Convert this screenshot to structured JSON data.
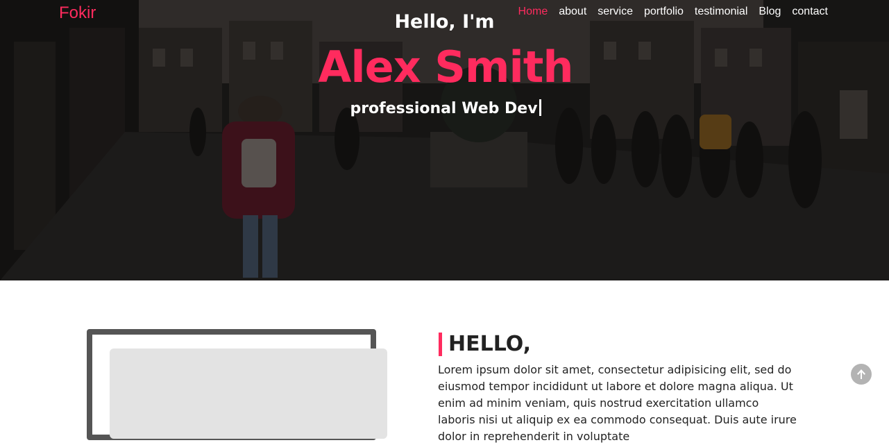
{
  "brand": {
    "name": "Fokir",
    "color": "#ff2b5e"
  },
  "nav": {
    "items": [
      {
        "label": "Home",
        "active": true
      },
      {
        "label": "about"
      },
      {
        "label": "service"
      },
      {
        "label": "portfolio"
      },
      {
        "label": "testimonial"
      },
      {
        "label": "Blog"
      },
      {
        "label": "contact"
      }
    ]
  },
  "hero": {
    "greeting": "Hello, I'm",
    "name": "Alex Smith",
    "role": "professional Web Dev",
    "background_icon": "street-photo"
  },
  "about": {
    "heading": "HELLO,",
    "text": "Lorem ipsum dolor sit amet, consectetur adipisicing elit, sed do eiusmod tempor incididunt ut labore et dolore magna aliqua. Ut enim ad minim veniam, quis nostrud exercitation ullamco laboris nisi ut aliquip ex ea commodo consequat. Duis aute irure dolor in reprehenderit in voluptate"
  },
  "scroll_top": {
    "icon": "arrow-up-icon"
  },
  "colors": {
    "accent": "#ff2b5e",
    "text": "#222222",
    "frame": "#555555"
  }
}
